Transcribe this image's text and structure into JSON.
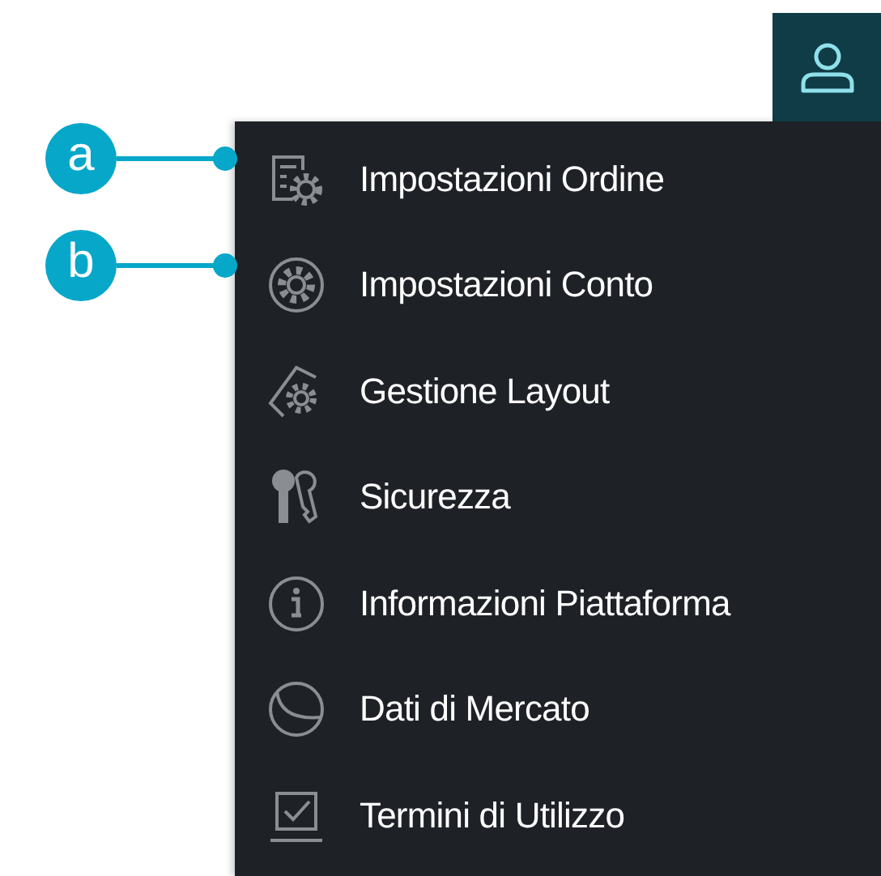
{
  "menu": {
    "items": [
      {
        "kind": "order-settings",
        "label": "Impostazioni Ordine"
      },
      {
        "kind": "account-settings",
        "label": "Impostazioni Conto"
      },
      {
        "kind": "layout",
        "label": "Gestione Layout"
      },
      {
        "kind": "security",
        "label": "Sicurezza"
      },
      {
        "kind": "info",
        "label": "Informazioni Piattaforma"
      },
      {
        "kind": "market",
        "label": "Dati di Mercato"
      },
      {
        "kind": "terms",
        "label": "Termini di Utilizzo"
      }
    ]
  },
  "callouts": [
    {
      "label": "a"
    },
    {
      "label": "b"
    }
  ]
}
